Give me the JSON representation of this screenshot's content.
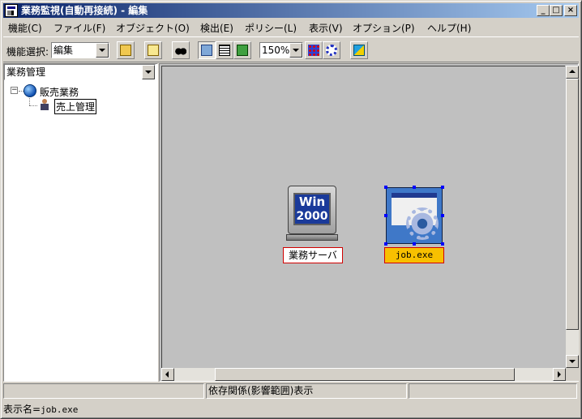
{
  "window": {
    "title": "業務監視(自動再接続) - 編集",
    "controls": {
      "minimize": "_",
      "maximize": "□",
      "close": "×"
    }
  },
  "menu": [
    "機能(C)",
    "ファイル(F)",
    "オブジェクト(O)",
    "検出(E)",
    "ポリシー(L)",
    "表示(V)",
    "オプション(P)",
    "ヘルプ(H)"
  ],
  "toolbar": {
    "function_label": "機能選択:",
    "function_value": "編集",
    "zoom_value": "150%",
    "buttons": [
      {
        "name": "open-icon"
      },
      {
        "name": "up-folder-icon"
      },
      {
        "name": "search-binoculars-icon"
      },
      {
        "name": "map-view-icon"
      },
      {
        "name": "list-view-icon"
      },
      {
        "name": "export-icon"
      },
      {
        "name": "grid-icon"
      },
      {
        "name": "circle-layout-icon"
      },
      {
        "name": "refresh-arrow-icon"
      }
    ]
  },
  "left_pane": {
    "dropdown_value": "業務管理",
    "tree": {
      "root_expander": "⊟",
      "root_label": "販売業務",
      "child_label": "売上管理"
    }
  },
  "canvas": {
    "server_node": {
      "screen_line1": "Win",
      "screen_line2": "2000",
      "label": "業務サーバ"
    },
    "job_node": {
      "label": "job.exe"
    }
  },
  "statusbar": {
    "panel1": "",
    "panel2": "依存関係(影響範囲)表示",
    "panel3": ""
  },
  "footer": {
    "label": "表示名=",
    "value": "job.exe"
  },
  "colors": {
    "title_start": "#0a246a",
    "title_end": "#a6caf0",
    "selection": "#f8c000",
    "node_border": "#d00000"
  }
}
